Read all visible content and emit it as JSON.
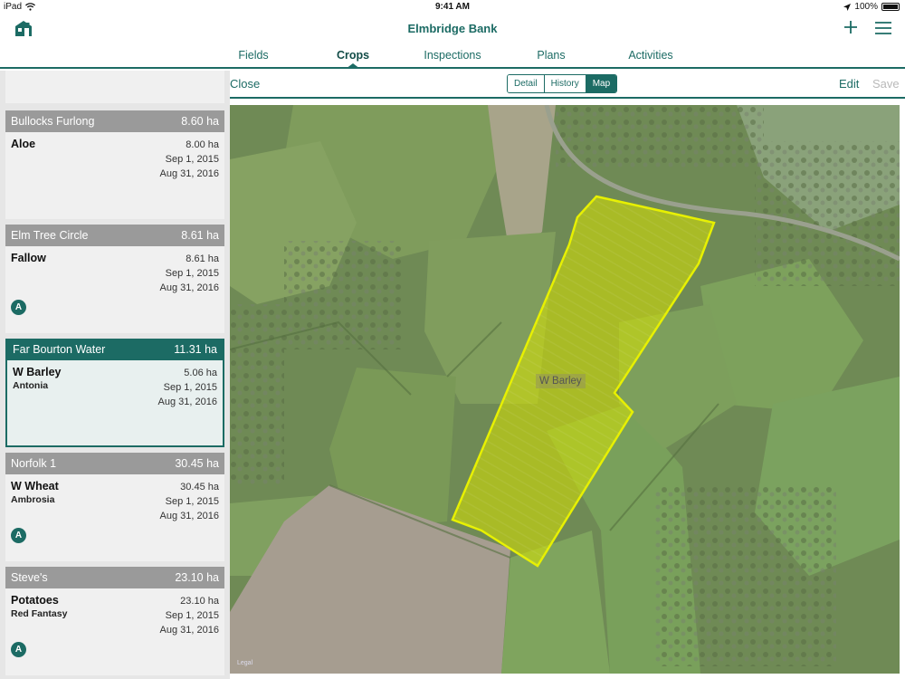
{
  "status_bar": {
    "device": "iPad",
    "time": "9:41 AM",
    "battery": "100%"
  },
  "header": {
    "title": "Elmbridge Bank",
    "tabs": [
      {
        "label": "Fields"
      },
      {
        "label": "Crops"
      },
      {
        "label": "Inspections"
      },
      {
        "label": "Plans"
      },
      {
        "label": "Activities"
      }
    ],
    "active_tab": "Crops"
  },
  "toolbar": {
    "close_label": "Close",
    "segments": [
      {
        "label": "Detail"
      },
      {
        "label": "History"
      },
      {
        "label": "Map"
      }
    ],
    "active_segment": "Map",
    "edit_label": "Edit",
    "save_label": "Save"
  },
  "fields": [
    {
      "field": "Bullocks Furlong",
      "field_area": "8.60 ha",
      "crop": "Aloe",
      "variety": "",
      "crop_area": "8.00 ha",
      "start": "Sep 1, 2015",
      "end": "Aug 31, 2016",
      "badge": ""
    },
    {
      "field": "Elm Tree Circle",
      "field_area": "8.61 ha",
      "crop": "Fallow",
      "variety": "",
      "crop_area": "8.61 ha",
      "start": "Sep 1, 2015",
      "end": "Aug 31, 2016",
      "badge": "A"
    },
    {
      "field": "Far Bourton Water",
      "field_area": "11.31 ha",
      "crop": "W Barley",
      "variety": "Antonia",
      "crop_area": "5.06 ha",
      "start": "Sep 1, 2015",
      "end": "Aug 31, 2016",
      "badge": ""
    },
    {
      "field": "Norfolk 1",
      "field_area": "30.45 ha",
      "crop": "W Wheat",
      "variety": "Ambrosia",
      "crop_area": "30.45 ha",
      "start": "Sep 1, 2015",
      "end": "Aug 31, 2016",
      "badge": "A"
    },
    {
      "field": "Steve's",
      "field_area": "23.10 ha",
      "crop": "Potatoes",
      "variety": "Red Fantasy",
      "crop_area": "23.10 ha",
      "start": "Sep 1, 2015",
      "end": "Aug 31, 2016",
      "badge": "A"
    }
  ],
  "selected_field": "Far Bourton Water",
  "map": {
    "polygon_label": "W Barley",
    "credit": "Legal",
    "polygon_color": "#d9e400"
  },
  "colors": {
    "brand": "#1c6b64",
    "header_grey": "#9a9a9a"
  }
}
